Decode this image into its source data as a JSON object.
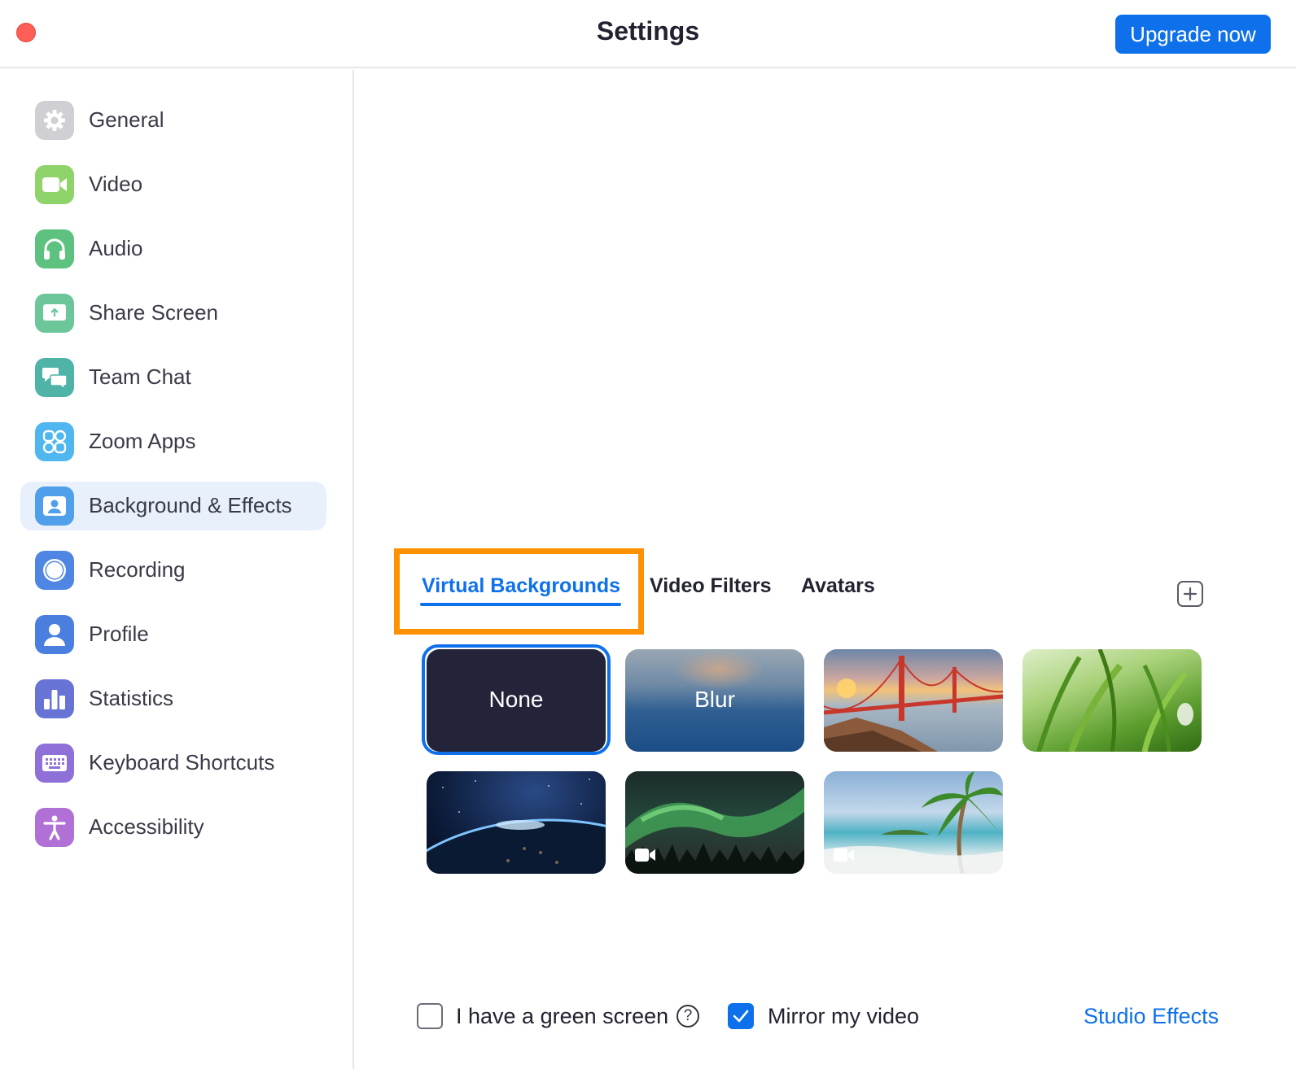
{
  "window": {
    "title": "Settings",
    "upgrade_label": "Upgrade now"
  },
  "sidebar": {
    "items": [
      {
        "label": "General",
        "icon": "gear-icon",
        "color": "#c9c9ce"
      },
      {
        "label": "Video",
        "icon": "video-camera-icon",
        "color": "#8fd46a"
      },
      {
        "label": "Audio",
        "icon": "headphones-icon",
        "color": "#5dc27f"
      },
      {
        "label": "Share Screen",
        "icon": "share-screen-icon",
        "color": "#6cc69a"
      },
      {
        "label": "Team Chat",
        "icon": "chat-bubbles-icon",
        "color": "#4fb3a8"
      },
      {
        "label": "Zoom Apps",
        "icon": "apps-icon",
        "color": "#4fb6ef"
      },
      {
        "label": "Background & Effects",
        "icon": "background-person-icon",
        "color": "#4f9fea",
        "active": true
      },
      {
        "label": "Recording",
        "icon": "record-icon",
        "color": "#4f86e3"
      },
      {
        "label": "Profile",
        "icon": "profile-icon",
        "color": "#4a7fe0"
      },
      {
        "label": "Statistics",
        "icon": "bar-chart-icon",
        "color": "#6774d6"
      },
      {
        "label": "Keyboard Shortcuts",
        "icon": "keyboard-icon",
        "color": "#8f6fd8"
      },
      {
        "label": "Accessibility",
        "icon": "accessibility-icon",
        "color": "#b070d6"
      }
    ]
  },
  "tabs": [
    {
      "label": "Virtual Backgrounds",
      "active": true
    },
    {
      "label": "Video Filters",
      "active": false
    },
    {
      "label": "Avatars",
      "active": false
    }
  ],
  "backgrounds": [
    {
      "label": "None",
      "selected": true
    },
    {
      "label": "Blur",
      "selected": false
    },
    {
      "label": "",
      "kind": "golden-gate-bridge"
    },
    {
      "label": "",
      "kind": "grass"
    },
    {
      "label": "",
      "kind": "earth-from-space"
    },
    {
      "label": "",
      "kind": "northern-lights",
      "video": true
    },
    {
      "label": "",
      "kind": "beach-palm",
      "video": true
    }
  ],
  "options": {
    "green_screen_label": "I have a green screen",
    "green_screen_checked": false,
    "mirror_label": "Mirror my video",
    "mirror_checked": true,
    "studio_effects_label": "Studio Effects"
  },
  "colors": {
    "accent": "#0e71eb",
    "highlight": "#ff9100",
    "close": "#ff5f57"
  }
}
